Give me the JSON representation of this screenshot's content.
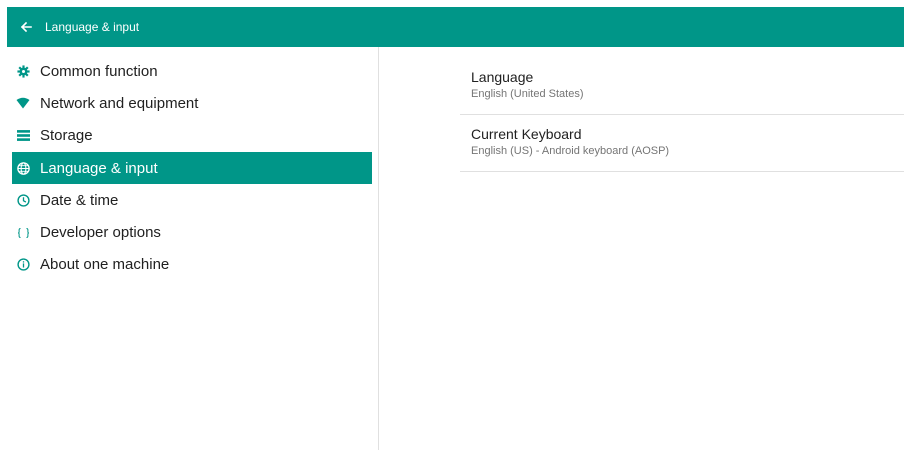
{
  "appbar": {
    "title": "Language & input",
    "back_icon": "arrow-left-icon"
  },
  "sidebar": {
    "items": [
      {
        "label": "Common function",
        "icon": "gear-icon"
      },
      {
        "label": "Network and equipment",
        "icon": "wifi-icon"
      },
      {
        "label": "Storage",
        "icon": "storage-icon"
      },
      {
        "label": "Language & input",
        "icon": "globe-icon",
        "selected": true
      },
      {
        "label": "Date & time",
        "icon": "clock-icon"
      },
      {
        "label": "Developer options",
        "icon": "braces-icon"
      },
      {
        "label": "About one machine",
        "icon": "info-icon"
      }
    ]
  },
  "content": {
    "prefs": [
      {
        "title": "Language",
        "summary": "English (United States)"
      },
      {
        "title": "Current Keyboard",
        "summary": "English (US) - Android keyboard (AOSP)"
      }
    ]
  },
  "colors": {
    "accent": "#009688",
    "icon": "#009688",
    "text": "#212121",
    "subtext": "#757575",
    "divider": "#e0e0e0"
  }
}
